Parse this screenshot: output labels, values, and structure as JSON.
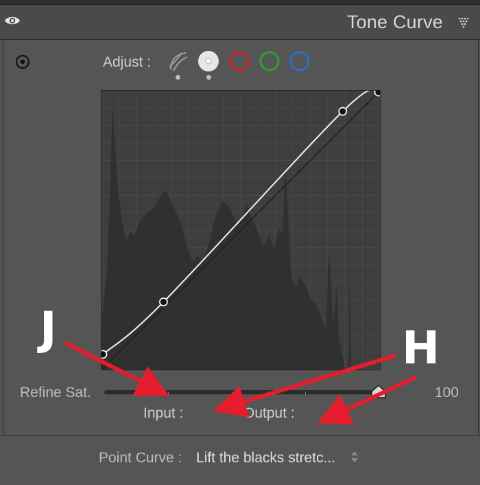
{
  "header": {
    "title": "Tone Curve",
    "eye_icon": "eye-icon",
    "collapse_icon": "triangle-dotted-icon"
  },
  "adjust": {
    "label": "Adjust :",
    "channels": [
      {
        "name": "parametric",
        "icon": "parametric-curve-icon",
        "selected": true
      },
      {
        "name": "point",
        "icon": "point-curve-icon",
        "selected": true
      },
      {
        "name": "red",
        "color": "#d2232a"
      },
      {
        "name": "green",
        "color": "#2ea02e"
      },
      {
        "name": "blue",
        "color": "#2d6fd1"
      }
    ]
  },
  "curve": {
    "points": [
      {
        "input": 0,
        "output": 5
      },
      {
        "input": 22,
        "output": 24
      },
      {
        "input": 87,
        "output": 93
      },
      {
        "input": 100,
        "output": 100
      }
    ]
  },
  "refine": {
    "label": "Refine Sat.",
    "value": "100",
    "level": 1.0
  },
  "input_label": "Input :",
  "output_label": "Output :",
  "point_curve": {
    "label": "Point Curve :",
    "value": "Lift the blacks stretc..."
  },
  "annotations": [
    {
      "letter": "J"
    },
    {
      "letter": "H"
    }
  ],
  "colors": {
    "arrow": "#e51d2c",
    "panel_bg": "#535353",
    "graph_bg": "#3e3e3e",
    "histogram": "#2f2f2f"
  }
}
